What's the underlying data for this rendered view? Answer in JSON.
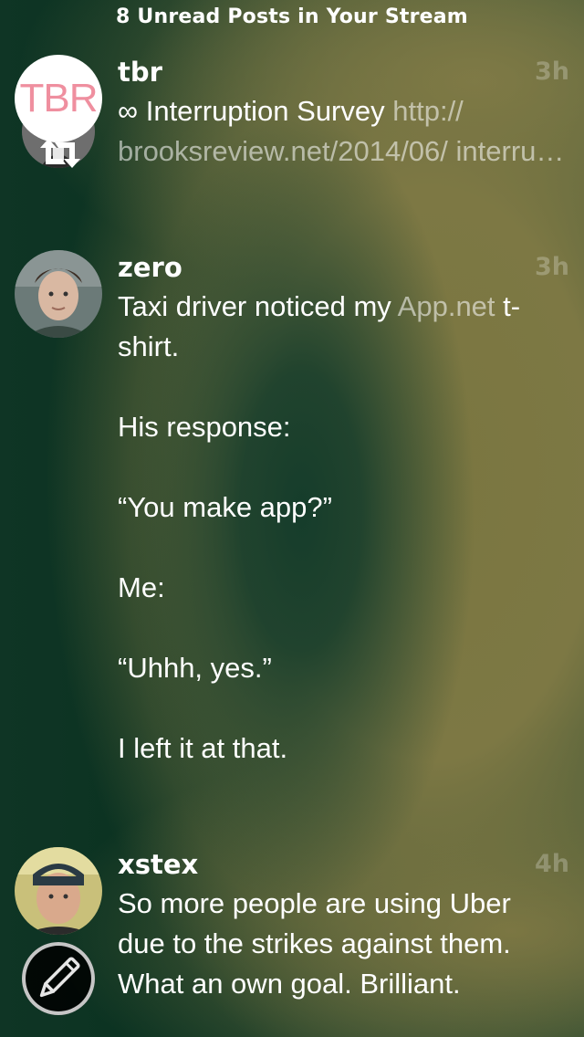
{
  "header": {
    "unread_label": "8 Unread Posts in Your Stream"
  },
  "posts": [
    {
      "username": "tbr",
      "time": "3h",
      "avatar_text": "TBR",
      "prefix": "∞ Interruption Survey ",
      "link": "http:// brooksreview.net/2014/06/ interru…",
      "repost": true
    },
    {
      "username": "zero",
      "time": "3h",
      "text_before": "Taxi driver noticed my ",
      "link": "App.net",
      "text_after": " t-shirt.\n\nHis response:\n\n“You make app?”\n\nMe:\n\n“Uhhh, yes.”\n\nI left it at that."
    },
    {
      "username": "xstex",
      "time": "4h",
      "text": "So more people are using Uber due to the strikes against them. What an own goal. Brilliant."
    }
  ],
  "compose": {
    "icon": "pencil-icon"
  },
  "colors": {
    "link": "#a9b3a8",
    "timestamp": "#5d6a52"
  }
}
